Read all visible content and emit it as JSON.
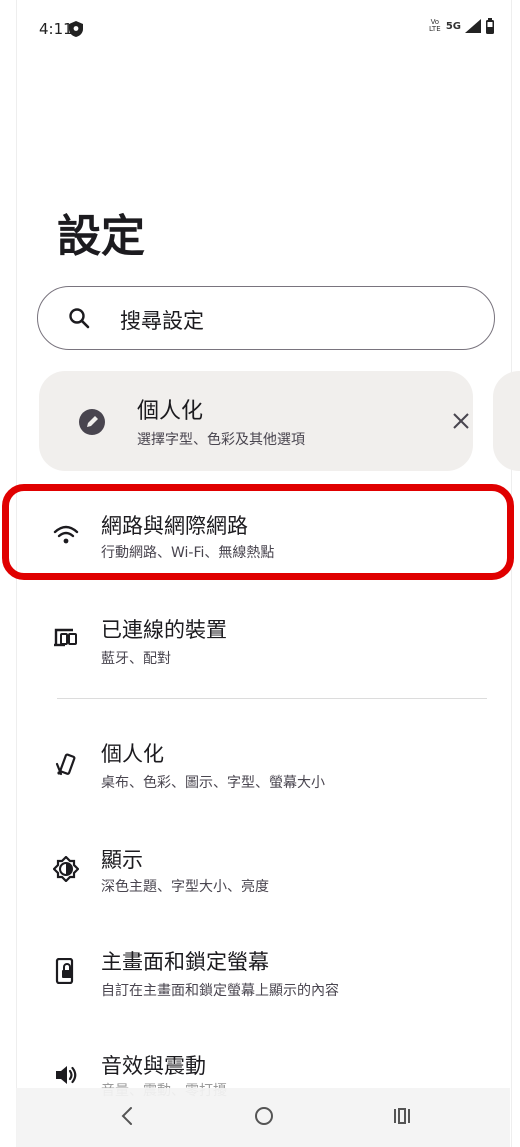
{
  "status_bar": {
    "time": "4:11",
    "volte": "Vo LTE",
    "network": "5G"
  },
  "page": {
    "title": "設定"
  },
  "search": {
    "placeholder": "搜尋設定"
  },
  "suggestion_card": {
    "title": "個人化",
    "subtitle": "選擇字型、色彩及其他選項",
    "icon": "brush-icon",
    "dismiss_icon": "close-icon"
  },
  "settings_items": [
    {
      "id": "network",
      "title": "網路與網際網路",
      "subtitle": "行動網路、Wi-Fi、無線熱點",
      "icon": "wifi-icon"
    },
    {
      "id": "connected-devices",
      "title": "已連線的裝置",
      "subtitle": "藍牙、配對",
      "icon": "devices-icon"
    },
    {
      "id": "personalization",
      "title": "個人化",
      "subtitle": "桌布、色彩、圖示、字型、螢幕大小",
      "icon": "palette-icon"
    },
    {
      "id": "display",
      "title": "顯示",
      "subtitle": "深色主題、字型大小、亮度",
      "icon": "brightness-icon"
    },
    {
      "id": "home-lock",
      "title": "主畫面和鎖定螢幕",
      "subtitle": "自訂在主畫面和鎖定螢幕上顯示的內容",
      "icon": "lock-screen-icon"
    },
    {
      "id": "sound",
      "title": "音效與震動",
      "subtitle": "音量、震動、零打擾",
      "icon": "volume-icon"
    }
  ],
  "nav_bar": {
    "back": "back-icon",
    "home": "home-icon",
    "recents": "recents-icon"
  },
  "colors": {
    "highlight": "#e00000",
    "card_bg": "#f1efed",
    "text_primary": "#1c1b1f",
    "text_secondary": "#49454f"
  }
}
